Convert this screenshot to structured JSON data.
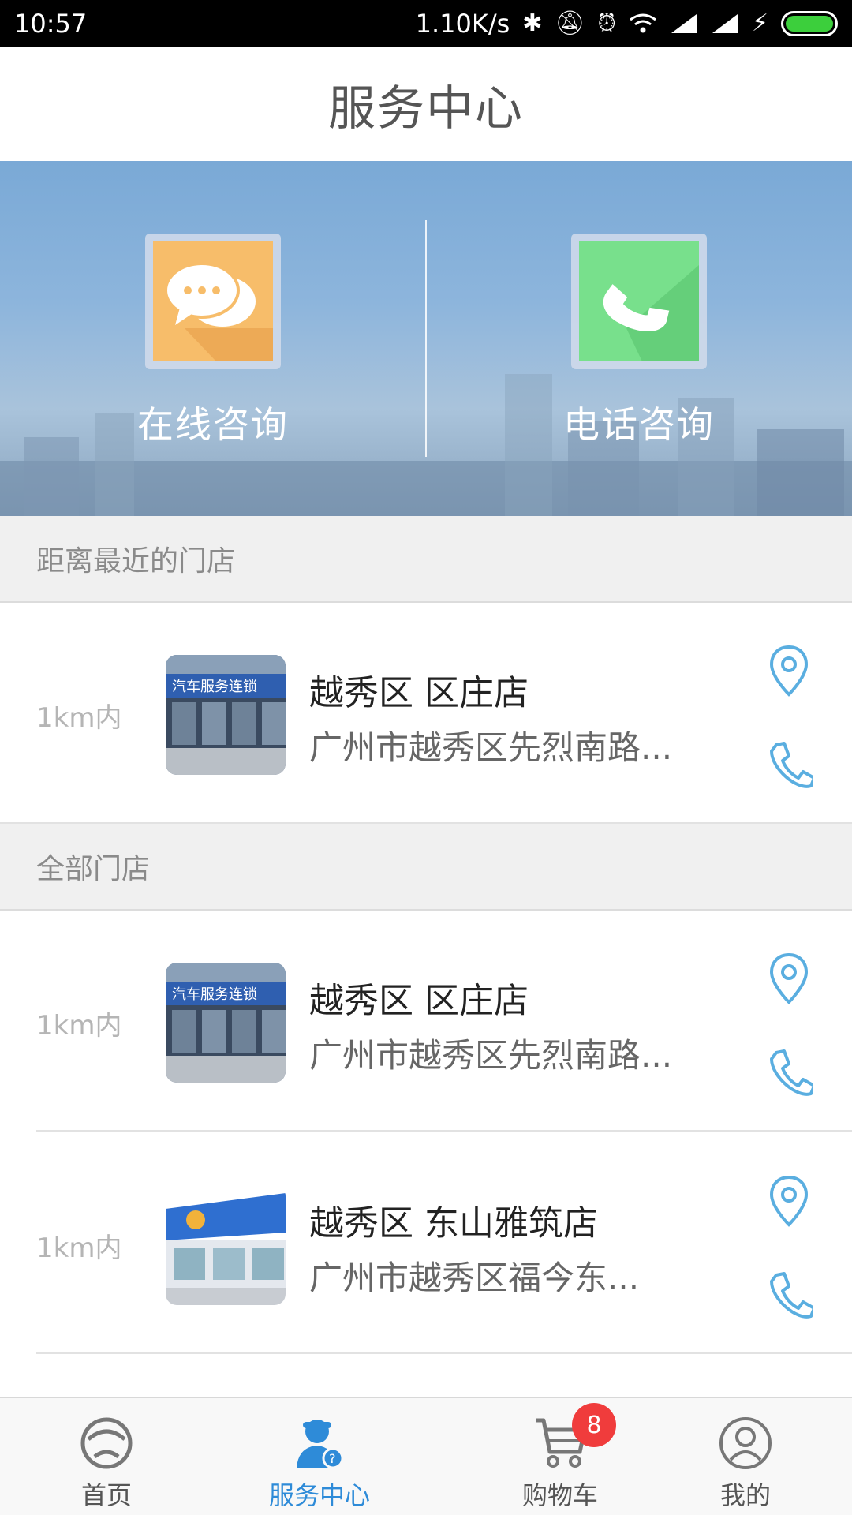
{
  "status_bar": {
    "time": "10:57",
    "net_speed": "1.10K/s",
    "network_type": "4G\n1X",
    "icons": [
      "bluetooth-icon",
      "bell-off-icon",
      "alarm-icon",
      "wifi-icon",
      "signal-icon",
      "signal-icon",
      "charging-icon",
      "battery-icon"
    ],
    "battery_level": 1.0
  },
  "header": {
    "title": "服务中心"
  },
  "hero": {
    "online": {
      "label": "在线咨询",
      "icon": "chat-bubbles-icon"
    },
    "phone": {
      "label": "电话咨询",
      "icon": "phone-handset-icon"
    }
  },
  "sections": {
    "nearest": "距离最近的门店",
    "all": "全部门店"
  },
  "nearest_store": {
    "distance": "1km内",
    "name": "越秀区 区庄店",
    "address": "广州市越秀区先烈南路..."
  },
  "stores": [
    {
      "distance": "1km内",
      "name": "越秀区 区庄店",
      "address": "广州市越秀区先烈南路..."
    },
    {
      "distance": "1km内",
      "name": "越秀区 东山雅筑店",
      "address": "广州市越秀区福今东..."
    }
  ],
  "nav": {
    "home": "首页",
    "service": "服务中心",
    "cart": "购物车",
    "cart_count": "8",
    "mine": "我的"
  },
  "colors": {
    "accent": "#2e8bd8",
    "icon_blue": "#5aaee0",
    "badge": "#f03c3c",
    "chat_tile": "#f7bd6a",
    "phone_tile": "#78e08c"
  }
}
